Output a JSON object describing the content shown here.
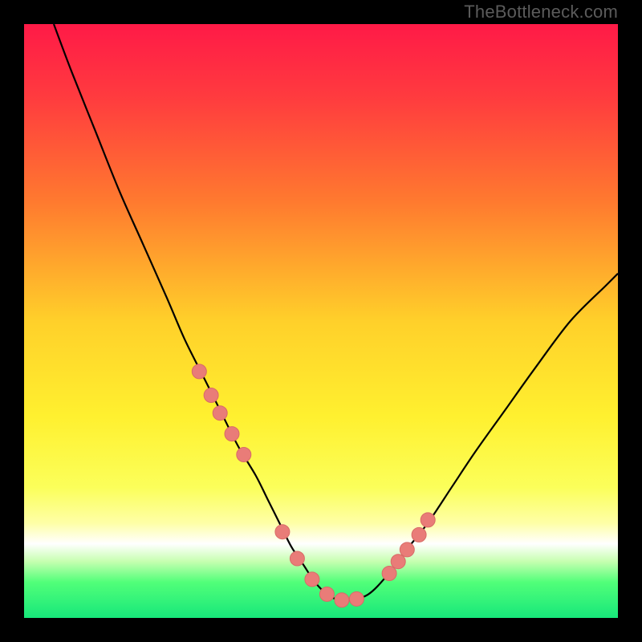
{
  "watermark": "TheBottleneck.com",
  "colors": {
    "frame": "#000000",
    "curve": "#000000",
    "marker_fill": "#e97c78",
    "marker_stroke": "#d86b67",
    "gradient_stops": [
      {
        "offset": 0.0,
        "color": "#ff1a47"
      },
      {
        "offset": 0.12,
        "color": "#ff3a3f"
      },
      {
        "offset": 0.3,
        "color": "#ff7a2f"
      },
      {
        "offset": 0.5,
        "color": "#ffd02a"
      },
      {
        "offset": 0.66,
        "color": "#fff02f"
      },
      {
        "offset": 0.78,
        "color": "#fbff5a"
      },
      {
        "offset": 0.84,
        "color": "#feffa6"
      },
      {
        "offset": 0.875,
        "color": "#ffffff"
      },
      {
        "offset": 0.905,
        "color": "#c6ffb0"
      },
      {
        "offset": 0.94,
        "color": "#51ff79"
      },
      {
        "offset": 1.0,
        "color": "#17e77a"
      }
    ]
  },
  "chart_data": {
    "type": "line",
    "title": "",
    "xlabel": "",
    "ylabel": "",
    "xlim": [
      0,
      100
    ],
    "ylim": [
      0,
      100
    ],
    "series": [
      {
        "name": "bottleneck-curve",
        "x": [
          5,
          8,
          12,
          16,
          20,
          24,
          27,
          30,
          33,
          36,
          39,
          41,
          43,
          45,
          47,
          49,
          51,
          53,
          55,
          58,
          61,
          64,
          68,
          72,
          76,
          81,
          86,
          92,
          98,
          100
        ],
        "y": [
          100,
          92,
          82,
          72,
          63,
          54,
          47,
          41,
          35,
          29,
          24,
          20,
          16,
          12,
          9,
          6,
          4,
          3,
          3,
          4,
          7,
          11,
          16,
          22,
          28,
          35,
          42,
          50,
          56,
          58
        ]
      }
    ],
    "markers": {
      "name": "highlight-points",
      "x": [
        29.5,
        31.5,
        33.0,
        35.0,
        37.0,
        43.5,
        46.0,
        48.5,
        51.0,
        53.5,
        56.0,
        61.5,
        63.0,
        64.5,
        66.5,
        68.0
      ],
      "y": [
        41.5,
        37.5,
        34.5,
        31.0,
        27.5,
        14.5,
        10.0,
        6.5,
        4.0,
        3.0,
        3.2,
        7.5,
        9.5,
        11.5,
        14.0,
        16.5
      ],
      "r": 9
    }
  }
}
